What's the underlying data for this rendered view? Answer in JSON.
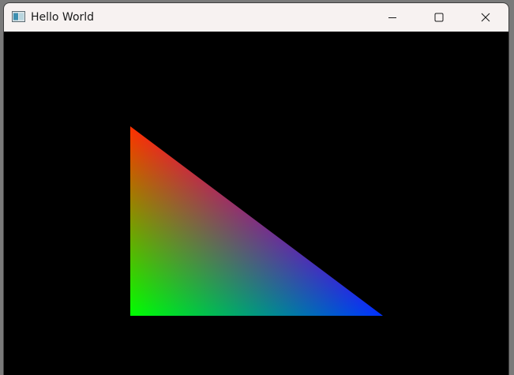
{
  "window": {
    "title": "Hello World",
    "controls": {
      "minimize_icon": "minimize-icon",
      "maximize_icon": "maximize-icon",
      "close_icon": "close-icon"
    }
  },
  "viewport": {
    "background_color": "#000000",
    "triangle": {
      "vertex_colors": {
        "top": "#ff0000",
        "bottom_left": "#00ff00",
        "bottom_right": "#0000ff"
      }
    }
  }
}
